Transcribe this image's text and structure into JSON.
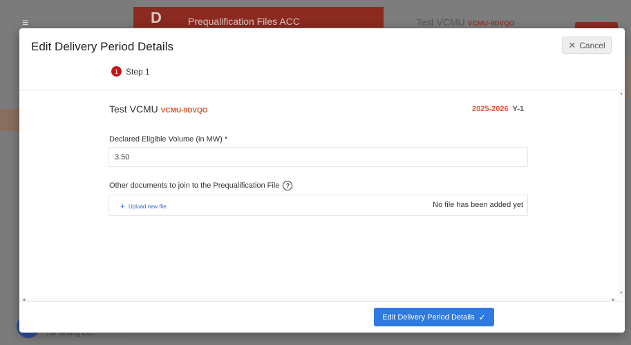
{
  "background": {
    "app_title": "Prequalification Files ACC",
    "unit_name": "Test VCMU",
    "unit_code": "VCMU-9DVQO",
    "user_name": "TW Testing Co...",
    "hamburger_glyph": "≡",
    "logo_glyph": "D",
    "caret_glyph": "⌃"
  },
  "modal": {
    "title": "Edit Delivery Period Details",
    "cancel_label": "Cancel",
    "cancel_glyph": "✕",
    "step": {
      "number": "1",
      "label": "Step 1"
    },
    "unit": {
      "name": "Test VCMU",
      "code": "VCMU-9DVQO"
    },
    "period": {
      "years": "2025-2026",
      "label": "Y-1"
    },
    "volume_field": {
      "label": "Declared Eligible Volume (in MW) *",
      "value": "3.50"
    },
    "documents_field": {
      "label": "Other documents to join to the Prequalification File",
      "help_glyph": "?",
      "upload_label": "Upload new file",
      "upload_glyph": "+",
      "empty_text": "No file has been added yet"
    },
    "submit_label": "Edit Delivery Period Details",
    "submit_glyph": "✓",
    "scroll_glyphs": {
      "up": "▲",
      "down": "▼",
      "left": "◀",
      "right": "▶"
    }
  },
  "colors": {
    "accent": "#2f7ae0",
    "brand_red": "#c4131b",
    "code_orange": "#e5512b"
  }
}
